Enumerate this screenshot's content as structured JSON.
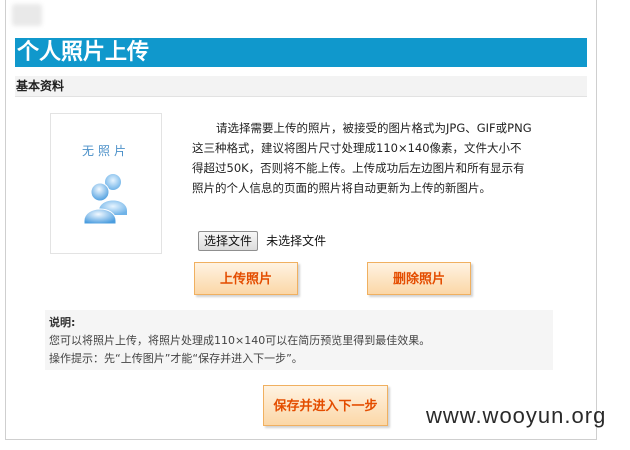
{
  "header": {
    "title": "个人照片上传"
  },
  "section": {
    "label": "基本资料"
  },
  "photo": {
    "placeholder_text": "无照片",
    "icon": "people-icon"
  },
  "instructions": {
    "text": "请选择需要上传的照片，被接受的图片格式为JPG、GIF或PNG这三种格式，建议将图片尺寸处理成110×140像素，文件大小不得超过50K，否则将不能上传。上传成功后左边图片和所有显示有照片的个人信息的页面的照片将自动更新为上传的新图片。"
  },
  "file_input": {
    "button_label": "选择文件",
    "status": "未选择文件"
  },
  "buttons": {
    "upload": "上传照片",
    "delete": "删除照片",
    "save_next": "保存并进入下一步"
  },
  "note": {
    "title": "说明:",
    "line1": "您可以将照片上传，将照片处理成110×140可以在简历预览里得到最佳效果。",
    "line2": "操作提示：先“上传图片”才能“保存并进入下一步”。"
  },
  "watermark": "www.wooyun.org",
  "colors": {
    "title_bg": "#1098cc",
    "button_text": "#e44d00",
    "button_border": "#f0b060"
  }
}
